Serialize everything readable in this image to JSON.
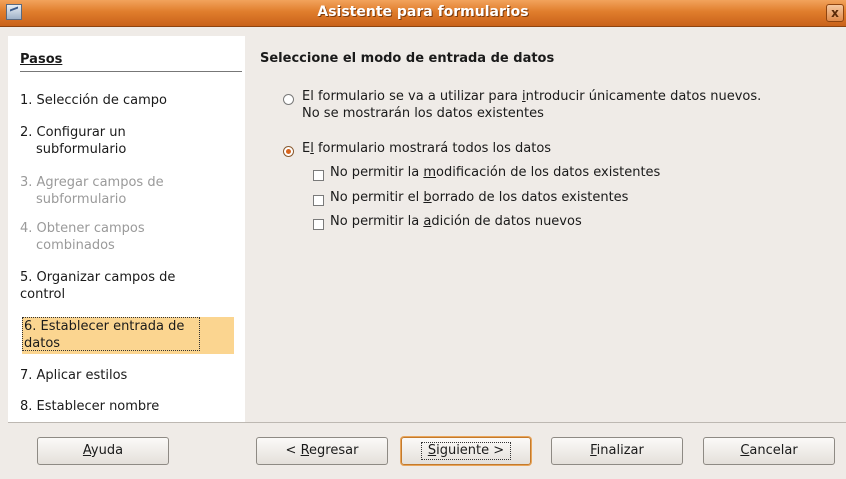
{
  "window": {
    "title": "Asistente para formularios",
    "close_glyph": "x"
  },
  "sidebar": {
    "title": "Pasos",
    "steps": [
      {
        "label_line1": "1. Selección de campo",
        "label_line2": ""
      },
      {
        "label_line1": "2. Configurar un",
        "label_line2": "subformulario"
      },
      {
        "label_line1": "3. Agregar campos de",
        "label_line2": "subformulario"
      },
      {
        "label_line1": "4. Obtener campos",
        "label_line2": "combinados"
      },
      {
        "label_line1": "5. Organizar campos de",
        "label_line2": "control"
      },
      {
        "label_line1": "6. Establecer entrada de",
        "label_line2": "datos"
      },
      {
        "label_line1": "7. Aplicar estilos",
        "label_line2": ""
      },
      {
        "label_line1": "8. Establecer nombre",
        "label_line2": ""
      }
    ]
  },
  "main": {
    "title": "Seleccione el modo de entrada de datos",
    "radio_new_only": {
      "line1_pre": "El formulario se va a utilizar para ",
      "line1_mnemonic": "i",
      "line1_post": "ntroducir únicamente datos nuevos.",
      "line2": "No se mostrarán los datos existentes",
      "selected": false
    },
    "radio_show_all": {
      "pre": "E",
      "mnemonic": "l",
      "post": " formulario mostrará todos los datos",
      "selected": true
    },
    "checkboxes": [
      {
        "pre": "No permitir la ",
        "mnemonic": "m",
        "post": "odificación de los datos existentes",
        "checked": false
      },
      {
        "pre": "No permitir el ",
        "mnemonic": "b",
        "post": "orrado de los datos existentes",
        "checked": false
      },
      {
        "pre": "No permitir la ",
        "mnemonic": "a",
        "post": "dición de datos nuevos",
        "checked": false
      }
    ]
  },
  "buttons": {
    "help": {
      "mnemonic": "A",
      "rest": "yuda"
    },
    "back": {
      "pre": "< ",
      "mnemonic": "R",
      "rest": "egresar"
    },
    "next": {
      "mnemonic": "S",
      "rest": "iguiente >"
    },
    "finish": {
      "mnemonic": "F",
      "rest": "inalizar"
    },
    "cancel": {
      "mnemonic": "C",
      "rest": "ancelar"
    }
  },
  "colors": {
    "titlebar": "#e07d2c",
    "active_step_highlight": "#fbd590",
    "radio_selected": "#d8641c"
  }
}
